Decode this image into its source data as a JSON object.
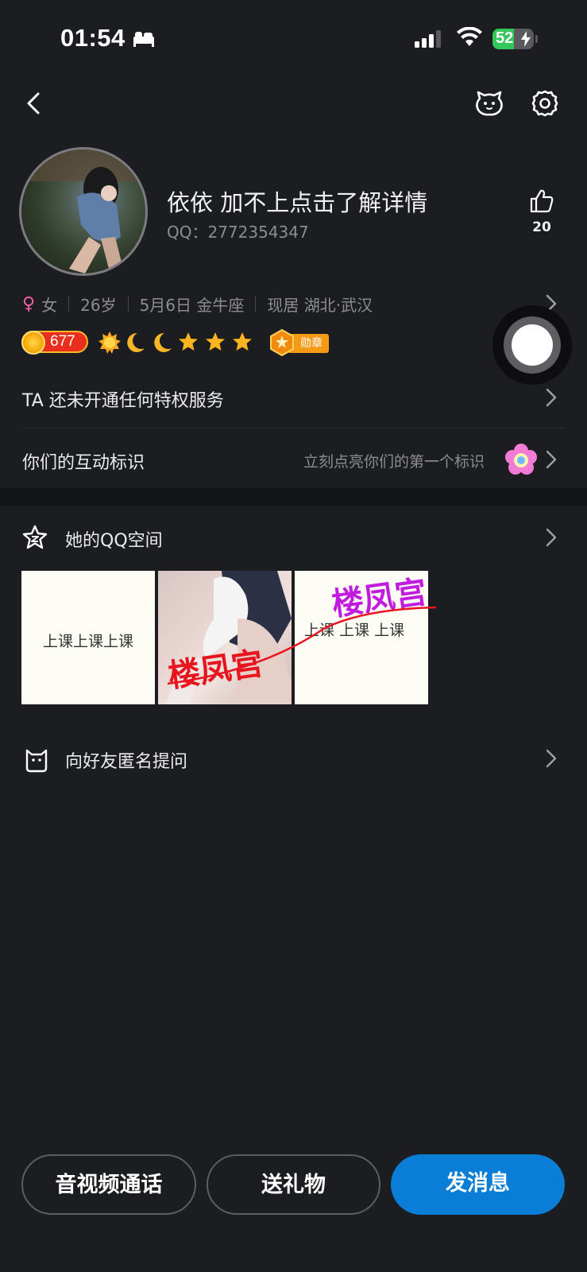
{
  "status_bar": {
    "time": "01:54",
    "battery_level": "52",
    "battery_fraction": 0.52
  },
  "profile": {
    "nickname": "依依 加不上点击了解详情",
    "qq_label": "QQ：2772354347",
    "like_count": "20",
    "gender_symbol": "♀",
    "gender": "女",
    "age": "26岁",
    "birthday": "5月6日 金牛座",
    "location": "现居 湖北·武汉",
    "coin_count": "677",
    "medal_label": "勋章"
  },
  "rows": {
    "vip_text": "TA 还未开通任何特权服务",
    "interaction_title": "你们的互动标识",
    "interaction_hint": "立刻点亮你们的第一个标识"
  },
  "qzone": {
    "title": "她的QQ空间",
    "thumbs": [
      {
        "text": "上课上课上课"
      },
      {
        "watermark": "楼凤宫"
      },
      {
        "text": "上课   上课   上课",
        "watermark": "楼凤宫"
      }
    ]
  },
  "anon_question": {
    "title": "向好友匿名提问"
  },
  "actions": {
    "call": "音视频通话",
    "gift": "送礼物",
    "message": "发消息"
  },
  "colors": {
    "primary": "#0a7dd6",
    "background": "#1c1d20",
    "watermark_red": "#e8141e",
    "watermark_purple": "#c21be0"
  }
}
